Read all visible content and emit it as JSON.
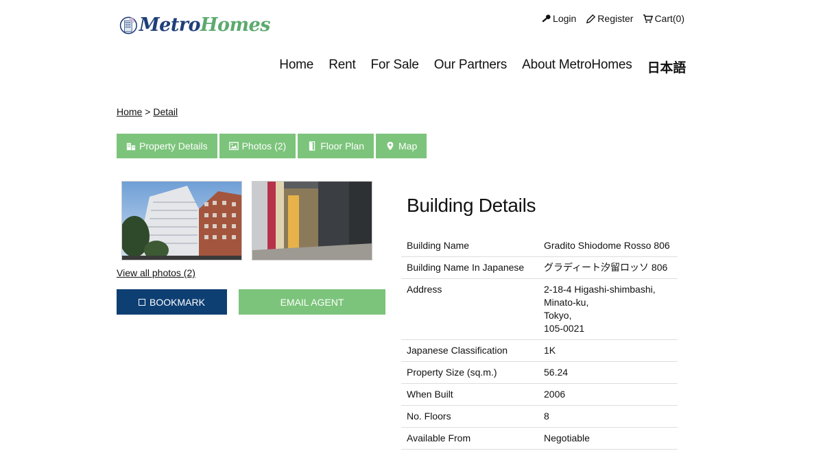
{
  "brand": {
    "part1": "Metro",
    "part2": "Homes"
  },
  "topbar": {
    "login": "Login",
    "register": "Register",
    "cart": "Cart(0)"
  },
  "nav": [
    "Home",
    "Rent",
    "For Sale",
    "Our Partners",
    "About MetroHomes",
    "日本語"
  ],
  "breadcrumb": {
    "home": "Home",
    "sep": " > ",
    "current": "Detail"
  },
  "tabs": [
    {
      "label": "Property Details",
      "icon": "building-icon"
    },
    {
      "label": "Photos (2)",
      "icon": "image-icon"
    },
    {
      "label": "Floor Plan",
      "icon": "door-icon"
    },
    {
      "label": "Map",
      "icon": "map-pin-icon"
    }
  ],
  "gallery": {
    "view_all": "View all photos (2)"
  },
  "actions": {
    "bookmark": "BOOKMARK",
    "email": "EMAIL AGENT"
  },
  "details": {
    "title": "Building Details",
    "rows": [
      {
        "label": "Building Name",
        "value": "Gradito Shiodome Rosso 806"
      },
      {
        "label": "Building Name In Japanese",
        "value": "グラディート汐留ロッソ 806"
      },
      {
        "label": "Address",
        "lines": [
          "2-18-4 Higashi-shimbashi,",
          "Minato-ku,",
          "Tokyo,",
          "105-0021"
        ]
      },
      {
        "label": "Japanese Classification",
        "value": "1K"
      },
      {
        "label": "Property Size (sq.m.)",
        "value": "56.24"
      },
      {
        "label": "When Built",
        "value": "2006"
      },
      {
        "label": "No. Floors",
        "value": "8"
      },
      {
        "label": "Available From",
        "value": "Negotiable"
      }
    ]
  },
  "colors": {
    "accent_green": "#7cc47b",
    "navy": "#0e3f73",
    "logo_blue": "#1f3f7a",
    "logo_green": "#5daa6e"
  }
}
